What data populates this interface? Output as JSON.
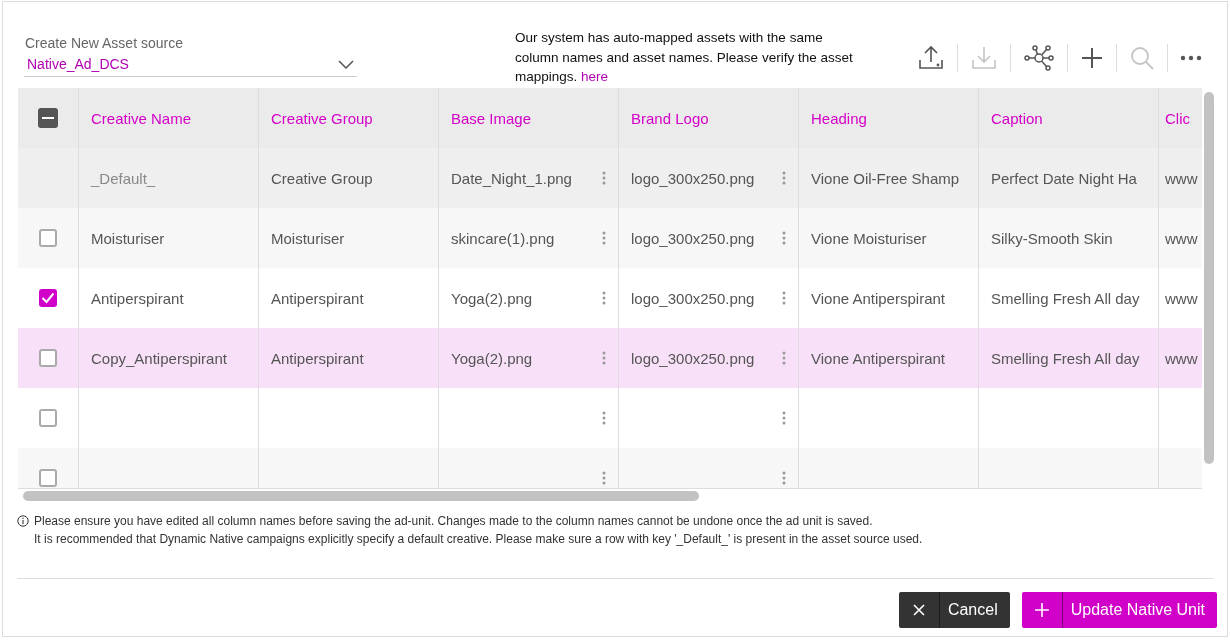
{
  "asset_source": {
    "label": "Create New Asset source",
    "value": "Native_Ad_DCS"
  },
  "info": {
    "text": "Our system has auto-mapped assets with the same column names and asset names. Please verify the asset mappings.",
    "link": "here"
  },
  "toolbar": [
    {
      "kind": "upload",
      "disabled": false
    },
    {
      "kind": "download",
      "disabled": true
    },
    {
      "kind": "network",
      "disabled": false
    },
    {
      "kind": "add",
      "disabled": false
    },
    {
      "kind": "search",
      "disabled": true
    },
    {
      "kind": "more",
      "disabled": false
    }
  ],
  "table": {
    "header_checkbox": {
      "indeterminate": true
    },
    "columns": [
      {
        "label": "Creative Name",
        "kind": "text"
      },
      {
        "label": "Creative Group",
        "kind": "text"
      },
      {
        "label": "Base Image",
        "kind": "file"
      },
      {
        "label": "Brand Logo",
        "kind": "file"
      },
      {
        "label": "Heading",
        "kind": "text"
      },
      {
        "label": "Caption",
        "kind": "text"
      },
      {
        "label": "Clic",
        "kind": "text"
      }
    ],
    "rows": [
      {
        "kind": "default",
        "highlighted": false,
        "cells": [
          "_Default_",
          "Creative Group",
          "Date_Night_1.png",
          "logo_300x250.png",
          "Vione Oil-Free Shamp",
          "Perfect Date Night Ha",
          "www"
        ]
      },
      {
        "kind": "item",
        "checked": false,
        "highlighted": false,
        "cells": [
          "Moisturiser",
          "Moisturiser",
          "skincare(1).png",
          "logo_300x250.png",
          "Vione Moisturiser",
          "Silky-Smooth Skin",
          "www"
        ]
      },
      {
        "kind": "item",
        "checked": true,
        "highlighted": false,
        "cells": [
          "Antiperspirant",
          "Antiperspirant",
          "Yoga(2).png",
          "logo_300x250.png",
          "Vione Antiperspirant",
          "Smelling Fresh All day",
          "www"
        ]
      },
      {
        "kind": "item",
        "checked": false,
        "highlighted": true,
        "cells": [
          "Copy_Antiperspirant",
          "Antiperspirant",
          "Yoga(2).png",
          "logo_300x250.png",
          "Vione Antiperspirant",
          "Smelling Fresh All day",
          "www"
        ]
      },
      {
        "kind": "item",
        "checked": false,
        "highlighted": false
      },
      {
        "kind": "item",
        "checked": false,
        "highlighted": false
      }
    ]
  },
  "notes": [
    "Please ensure you have edited all column names before saving the ad-unit. Changes made to the column names cannot be undone once the ad unit is saved.",
    "It is recommended that Dynamic Native campaigns explicitly specify a default creative. Please make sure a row with key '_Default_' is present in the asset source used."
  ],
  "buttons": [
    {
      "kind": "cancel",
      "label": "Cancel"
    },
    {
      "kind": "primary",
      "label": "Update Native Unit"
    }
  ]
}
